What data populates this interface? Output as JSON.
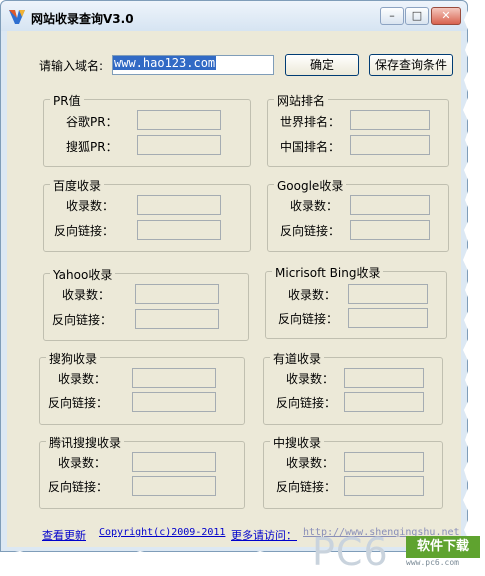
{
  "window": {
    "title": "网站收录查询V3.0",
    "minimize_glyph": "–",
    "maximize_glyph": "□",
    "close_glyph": "✕"
  },
  "domain": {
    "label": "请输入域名:",
    "value": "www.hao123.com",
    "confirm_label": "确定",
    "save_label": "保存查询条件"
  },
  "groups": {
    "pr": {
      "title": "PR值",
      "rows": [
        "谷歌PR：",
        "搜狐PR："
      ]
    },
    "rank": {
      "title": "网站排名",
      "rows": [
        "世界排名：",
        "中国排名："
      ]
    },
    "baidu": {
      "title": "百度收录",
      "rows": [
        "收录数：",
        "反向链接："
      ]
    },
    "google": {
      "title": "Google收录",
      "rows": [
        "收录数：",
        "反向链接："
      ]
    },
    "yahoo": {
      "title": "Yahoo收录",
      "rows": [
        "收录数：",
        "反向链接："
      ]
    },
    "bing": {
      "title": "Micrisoft Bing收录",
      "rows": [
        "收录数：",
        "反向链接："
      ]
    },
    "sogou": {
      "title": "搜狗收录",
      "rows": [
        "收录数：",
        "反向链接："
      ]
    },
    "youdao": {
      "title": "有道收录",
      "rows": [
        "收录数：",
        "反向链接："
      ]
    },
    "tencent": {
      "title": "腾讯搜搜收录",
      "rows": [
        "收录数：",
        "反向链接："
      ]
    },
    "zhongsou": {
      "title": "中搜收录",
      "rows": [
        "收录数：",
        "反向链接："
      ]
    }
  },
  "footer": {
    "update_link": "查看更新",
    "copyright": "Copyright(c)2009-2011",
    "more_text": "更多请访问：",
    "site_link": "http://www.shenqingshu.net"
  },
  "watermark": {
    "brand": "PC6",
    "tag": "软件下载",
    "sub": "www.pc6.com"
  },
  "colors": {
    "client_bg": "#ece9d8",
    "link": "#0000cc",
    "selection": "#316ac5",
    "watermark_tag": "#5fa32f"
  }
}
